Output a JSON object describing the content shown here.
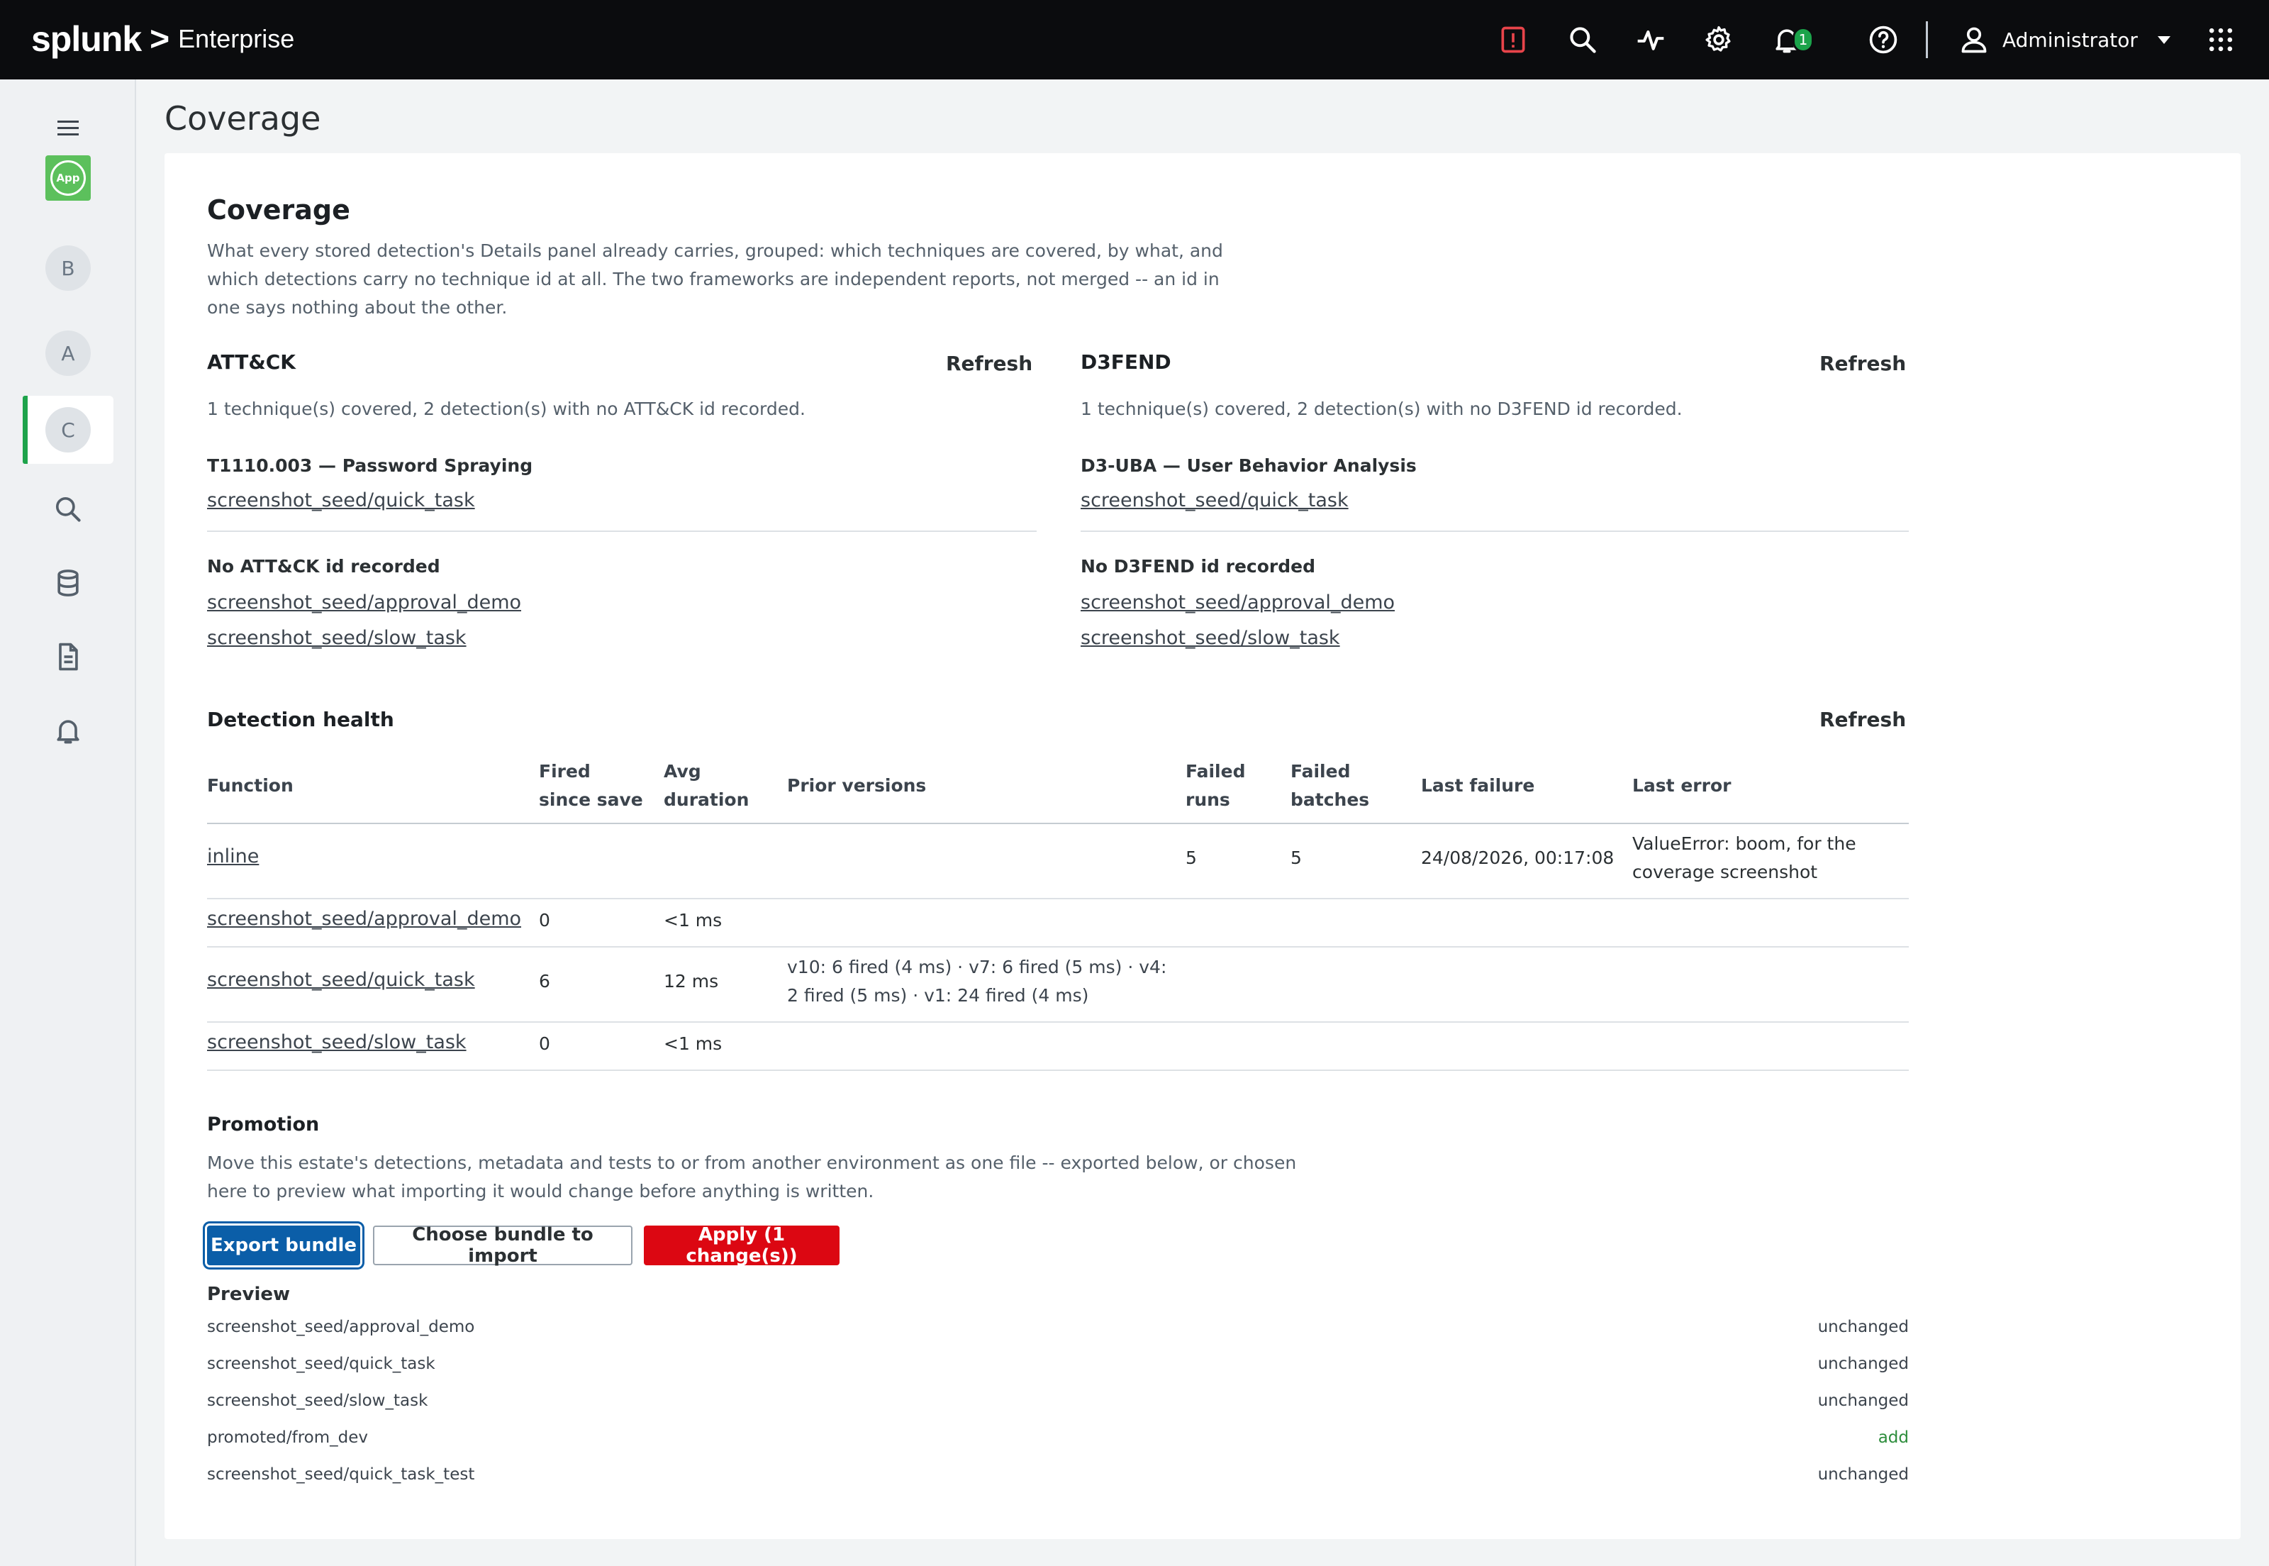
{
  "topbar": {
    "brand_word": "splunk",
    "brand_chevron": ">",
    "brand_product": "Enterprise",
    "notification_count": "1",
    "user_name": "Administrator",
    "colors": {
      "background": "#0b0c0e",
      "alert_icon": "#e8444a",
      "badge": "#1ba34a"
    }
  },
  "sidebar": {
    "app_badge": "App",
    "letters": [
      "B",
      "A",
      "C"
    ],
    "active_index": 2,
    "icons": [
      "menu-icon",
      "search-icon",
      "database-icon",
      "document-icon",
      "bell-icon"
    ]
  },
  "page": {
    "title": "Coverage",
    "heading": "Coverage",
    "intro": "What every stored detection's Details panel already carries, grouped: which techniques are covered, by what, and which detections carry no technique id at all. The two frameworks are independent reports, not merged -- an id in one says nothing about the other."
  },
  "attack": {
    "title": "ATT&CK",
    "refresh": "Refresh",
    "summary": "1 technique(s) covered, 2 detection(s) with no ATT&CK id recorded.",
    "technique_title": "T1110.003 — Password Spraying",
    "technique_detections": [
      "screenshot_seed/quick_task"
    ],
    "none_title": "No ATT&CK id recorded",
    "none_detections": [
      "screenshot_seed/approval_demo",
      "screenshot_seed/slow_task"
    ]
  },
  "d3fend": {
    "title": "D3FEND",
    "refresh": "Refresh",
    "summary": "1 technique(s) covered, 2 detection(s) with no D3FEND id recorded.",
    "technique_title": "D3-UBA — User Behavior Analysis",
    "technique_detections": [
      "screenshot_seed/quick_task"
    ],
    "none_title": "No D3FEND id recorded",
    "none_detections": [
      "screenshot_seed/approval_demo",
      "screenshot_seed/slow_task"
    ]
  },
  "health": {
    "title": "Detection health",
    "refresh": "Refresh",
    "columns": [
      "Function",
      "Fired since save",
      "Avg duration",
      "Prior versions",
      "Failed runs",
      "Failed batches",
      "Last failure",
      "Last error"
    ],
    "rows": [
      {
        "function": "inline",
        "fired": "",
        "avg": "",
        "prior": "",
        "failed_runs": "5",
        "failed_batches": "5",
        "last_failure": "24/08/2026, 00:17:08",
        "last_error": "ValueError: boom, for the coverage screenshot"
      },
      {
        "function": "screenshot_seed/approval_demo",
        "fired": "0",
        "avg": "<1 ms",
        "prior": "",
        "failed_runs": "",
        "failed_batches": "",
        "last_failure": "",
        "last_error": ""
      },
      {
        "function": "screenshot_seed/quick_task",
        "fired": "6",
        "avg": "12 ms",
        "prior": "v10: 6 fired (4 ms) · v7: 6 fired (5 ms) · v4: 2 fired (5 ms) · v1: 24 fired (4 ms)",
        "failed_runs": "",
        "failed_batches": "",
        "last_failure": "",
        "last_error": ""
      },
      {
        "function": "screenshot_seed/slow_task",
        "fired": "0",
        "avg": "<1 ms",
        "prior": "",
        "failed_runs": "",
        "failed_batches": "",
        "last_failure": "",
        "last_error": ""
      }
    ]
  },
  "promotion": {
    "title": "Promotion",
    "description": "Move this estate's detections, metadata and tests to or from another environment as one file -- exported below, or chosen here to preview what importing it would change before anything is written.",
    "export_label": "Export bundle",
    "import_label": "Choose bundle to import",
    "apply_label": "Apply (1 change(s))",
    "preview_title": "Preview",
    "preview": [
      {
        "name": "screenshot_seed/approval_demo",
        "status": "unchanged"
      },
      {
        "name": "screenshot_seed/quick_task",
        "status": "unchanged"
      },
      {
        "name": "screenshot_seed/slow_task",
        "status": "unchanged"
      },
      {
        "name": "promoted/from_dev",
        "status": "add"
      },
      {
        "name": "screenshot_seed/quick_task_test",
        "status": "unchanged"
      }
    ],
    "colors": {
      "primary": "#0b5ea8",
      "danger": "#dc0712",
      "add": "#2d8d3c"
    }
  }
}
